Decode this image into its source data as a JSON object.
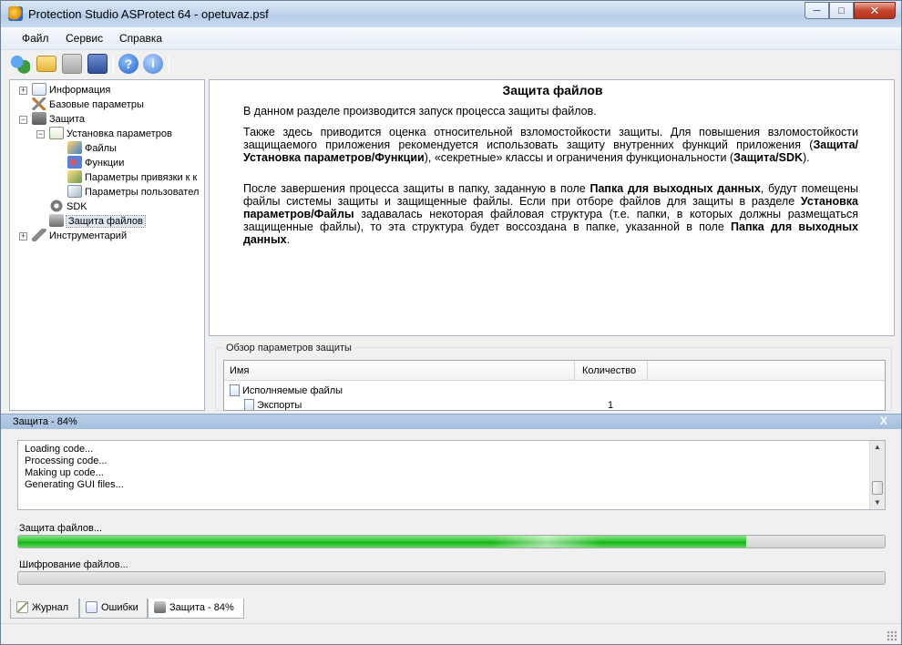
{
  "window": {
    "title": "Protection Studio ASProtect 64 - opetuvaz.psf"
  },
  "menu": [
    "Файл",
    "Сервис",
    "Справка"
  ],
  "tree": {
    "items": [
      {
        "label": "Информация",
        "icon": "info-icon"
      },
      {
        "label": "Базовые параметры",
        "icon": "tools-icon"
      },
      {
        "label": "Защита",
        "icon": "shield-icon"
      },
      {
        "label": "Установка параметров",
        "icon": "settings-icon"
      },
      {
        "label": "Файлы",
        "icon": "files-icon"
      },
      {
        "label": "Функции",
        "icon": "functions-icon"
      },
      {
        "label": "Параметры привязки к к",
        "icon": "binding-icon"
      },
      {
        "label": "Параметры пользовател",
        "icon": "user-params-icon"
      },
      {
        "label": "SDK",
        "icon": "sdk-gear-icon"
      },
      {
        "label": "Защита файлов",
        "icon": "protect-files-icon"
      },
      {
        "label": "Инструментарий",
        "icon": "wrench-icon"
      }
    ]
  },
  "content": {
    "title": "Защита файлов",
    "p1": "В данном разделе производится запуск процесса защиты файлов.",
    "p2_a": "Также здесь приводится оценка относительной взломостойкости защиты. Для повышения взломостойкости защищаемого приложения рекомендуется использовать защиту внутренних функций приложения (",
    "p2_b": "Защита/Установка параметров/Функции",
    "p2_c": "), «секретные» классы и ограничения функциональности (",
    "p2_d": "Защита/SDK",
    "p2_e": ").",
    "p3_a": "После завершения процесса защиты в папку, заданную в поле ",
    "p3_b": "Папка для выходных данных",
    "p3_c": ", будут помещены файлы системы защиты и защищенные файлы. Если при отборе файлов для защиты в разделе ",
    "p3_d": "Установка параметров/Файлы",
    "p3_e": " задавалась некоторая файловая структура (т.е. папки, в которых должны размещаться защищенные файлы), то эта структура будет воссоздана в папке, указанной в поле ",
    "p3_f": "Папка для выходных данных",
    "p3_g": "."
  },
  "overview": {
    "group_label": "Обзор параметров защиты",
    "col_name": "Имя",
    "col_count": "Количество",
    "rows": [
      {
        "name": "Исполняемые файлы",
        "count": ""
      },
      {
        "name": "Экспорты",
        "count": "1"
      }
    ]
  },
  "progress_panel": {
    "title": "Защита - 84%",
    "close": "X",
    "log": [
      "  Loading code...",
      "  Processing code...",
      "  Making up code...",
      "Generating GUI files..."
    ],
    "bar1_label": "Защита файлов...",
    "bar1_value": 0.84,
    "bar2_label": "Шифрование файлов...",
    "bar2_value": 0.0
  },
  "tabs": [
    {
      "label": "Журнал",
      "icon": "journal-icon"
    },
    {
      "label": "Ошибки",
      "icon": "errors-icon"
    },
    {
      "label": "Защита - 84%",
      "icon": "protect-progress-icon"
    }
  ],
  "colors": {
    "progress_green": "#22b822",
    "title_bar": "#c2d6ee",
    "selection": "#dfe7f1"
  }
}
